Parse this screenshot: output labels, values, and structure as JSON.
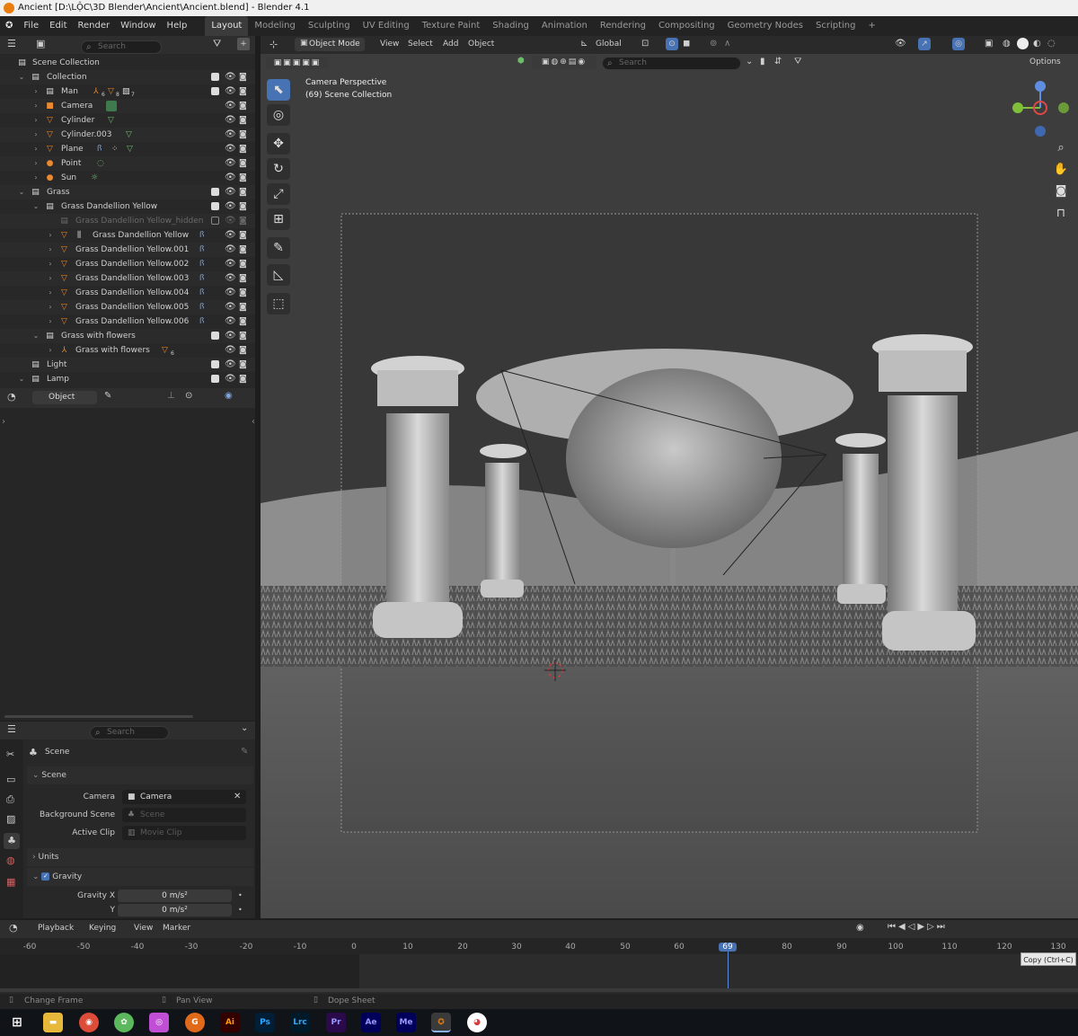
{
  "window": {
    "title": "Ancient [D:\\LỘC\\3D Blender\\Ancient\\Ancient.blend] - Blender 4.1"
  },
  "menu": [
    "File",
    "Edit",
    "Render",
    "Window",
    "Help"
  ],
  "workspaces": [
    "Layout",
    "Modeling",
    "Sculpting",
    "UV Editing",
    "Texture Paint",
    "Shading",
    "Animation",
    "Rendering",
    "Compositing",
    "Geometry Nodes",
    "Scripting",
    "+"
  ],
  "outliner": {
    "search_placeholder": "Search",
    "rows": [
      {
        "name": "Scene Collection"
      },
      {
        "name": "Collection"
      },
      {
        "name": "Man"
      },
      {
        "name": "Camera"
      },
      {
        "name": "Cylinder"
      },
      {
        "name": "Cylinder.003"
      },
      {
        "name": "Plane"
      },
      {
        "name": "Point"
      },
      {
        "name": "Sun"
      },
      {
        "name": "Grass"
      },
      {
        "name": "Grass Dandellion Yellow"
      },
      {
        "name": "Grass Dandellion Yellow_hidden"
      },
      {
        "name": "Grass Dandellion Yellow"
      },
      {
        "name": "Grass Dandellion Yellow.001"
      },
      {
        "name": "Grass Dandellion Yellow.002"
      },
      {
        "name": "Grass Dandellion Yellow.003"
      },
      {
        "name": "Grass Dandellion Yellow.004"
      },
      {
        "name": "Grass Dandellion Yellow.005"
      },
      {
        "name": "Grass Dandellion Yellow.006"
      },
      {
        "name": "Grass with flowers"
      },
      {
        "name": "Grass with flowers"
      },
      {
        "name": "Light"
      },
      {
        "name": "Lamp"
      }
    ],
    "badges": {
      "man": "6",
      "man2": "8",
      "man3": "7",
      "grass_flowers": "6"
    }
  },
  "viewport_header": {
    "mode": "Object Mode",
    "menus": [
      "View",
      "Select",
      "Add",
      "Object"
    ],
    "transform": "Global",
    "search_placeholder": "Search",
    "options": "Options"
  },
  "viewport": {
    "line1": "Camera Perspective",
    "line2": "(69) Scene Collection"
  },
  "props": {
    "search_placeholder": "Search",
    "context_label": "Scene",
    "panel_object": "Object",
    "section_scene": "Scene",
    "camera_label": "Camera",
    "camera_value": "Camera",
    "bg_label": "Background Scene",
    "bg_value": "Scene",
    "clip_label": "Active Clip",
    "clip_value": "Movie Clip",
    "section_units": "Units",
    "section_gravity": "Gravity",
    "gx_label": "Gravity X",
    "gx_value": "0 m/s²",
    "gy_label": "Y",
    "gy_value": "0 m/s²"
  },
  "timeline": {
    "menus": [
      "Playback",
      "Keying",
      "View",
      "Marker"
    ],
    "current_frame": "69",
    "ticks": [
      "-60",
      "-50",
      "-40",
      "-30",
      "-20",
      "-10",
      "0",
      "10",
      "20",
      "30",
      "40",
      "50",
      "60",
      "69",
      "80",
      "90",
      "100",
      "110",
      "120",
      "130"
    ],
    "tooltip": "Copy (Ctrl+C)"
  },
  "status": {
    "change_frame": "Change Frame",
    "pan_view": "Pan View",
    "dope_sheet": "Dope Sheet"
  },
  "taskbar": [
    "Ai",
    "Ps",
    "Lrc",
    "Pr",
    "Ae",
    "Me"
  ]
}
